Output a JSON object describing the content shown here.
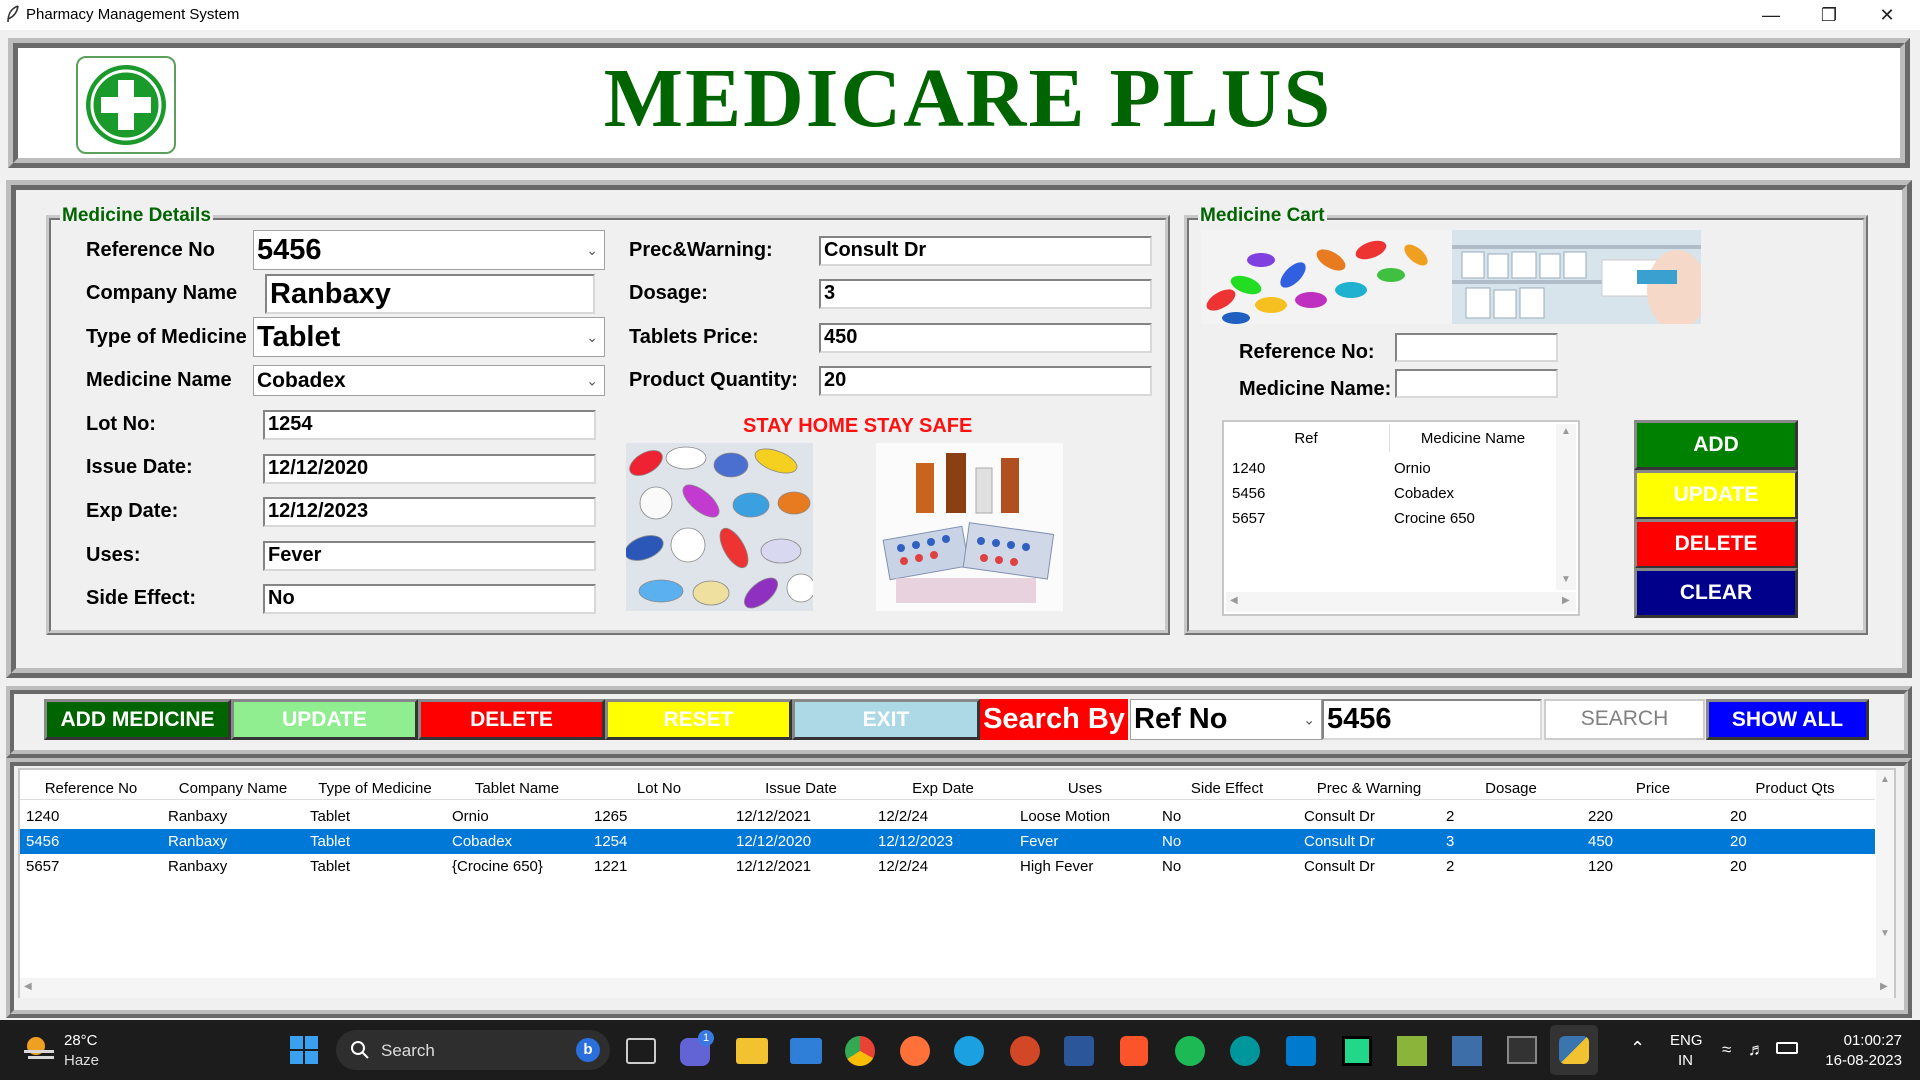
{
  "window": {
    "title": "Pharmacy Management System"
  },
  "header": {
    "title": "MEDICARE PLUS"
  },
  "medicine_details": {
    "group_label": "Medicine Details",
    "reference_no": {
      "label": "Reference No",
      "value": "5456"
    },
    "company_name": {
      "label": "Company Name",
      "value": "Ranbaxy"
    },
    "type_of_medicine": {
      "label": "Type of Medicine",
      "value": "Tablet"
    },
    "medicine_name": {
      "label": "Medicine Name",
      "value": "Cobadex"
    },
    "lot_no": {
      "label": "Lot No:",
      "value": "1254"
    },
    "issue_date": {
      "label": "Issue Date:",
      "value": "12/12/2020"
    },
    "exp_date": {
      "label": "Exp Date:",
      "value": "12/12/2023"
    },
    "uses": {
      "label": "Uses:",
      "value": "Fever"
    },
    "side_effect": {
      "label": "Side Effect:",
      "value": "No"
    },
    "prec_warning": {
      "label": "Prec&Warning:",
      "value": "Consult Dr"
    },
    "dosage": {
      "label": "Dosage:",
      "value": "3"
    },
    "tablets_price": {
      "label": "Tablets Price:",
      "value": "450"
    },
    "product_quantity": {
      "label": "Product Quantity:",
      "value": "20"
    },
    "slogan": "STAY HOME STAY SAFE"
  },
  "medicine_cart": {
    "group_label": "Medicine Cart",
    "reference_no": {
      "label": "Reference No:",
      "value": ""
    },
    "medicine_name": {
      "label": "Medicine Name:",
      "value": ""
    },
    "columns": [
      "Ref",
      "Medicine Name"
    ],
    "rows": [
      {
        "ref": "1240",
        "name": "Ornio"
      },
      {
        "ref": "5456",
        "name": "Cobadex"
      },
      {
        "ref": "5657",
        "name": "Crocine 650"
      }
    ],
    "buttons": {
      "add": "ADD",
      "update": "UPDATE",
      "delete": "DELETE",
      "clear": "CLEAR"
    }
  },
  "toolbar": {
    "add_medicine": "ADD MEDICINE",
    "update": "UPDATE",
    "delete": "DELETE",
    "reset": "RESET",
    "exit": "EXIT",
    "search_by_label": "Search By",
    "search_by_value": "Ref No",
    "search_value": "5456",
    "search": "SEARCH",
    "show_all": "SHOW ALL"
  },
  "table": {
    "columns": [
      "Reference No",
      "Company Name",
      "Type of Medicine",
      "Tablet Name",
      "Lot No",
      "Issue Date",
      "Exp Date",
      "Uses",
      "Side Effect",
      "Prec & Warning",
      "Dosage",
      "Price",
      "Product Qts"
    ],
    "rows": [
      [
        "1240",
        "Ranbaxy",
        "Tablet",
        "Ornio",
        "1265",
        "12/12/2021",
        "12/2/24",
        "Loose Motion",
        "No",
        "Consult Dr",
        "2",
        "220",
        "20"
      ],
      [
        "5456",
        "Ranbaxy",
        "Tablet",
        "Cobadex",
        "1254",
        "12/12/2020",
        "12/12/2023",
        "Fever",
        "No",
        "Consult Dr",
        "3",
        "450",
        "20"
      ],
      [
        "5657",
        "Ranbaxy",
        "Tablet",
        "{Crocine 650}",
        "1221",
        "12/12/2021",
        "12/2/24",
        "High Fever",
        "No",
        "Consult Dr",
        "2",
        "120",
        "20"
      ]
    ],
    "selected_row": 1
  },
  "taskbar": {
    "weather_temp": "28°C",
    "weather_desc": "Haze",
    "search_placeholder": "Search",
    "chat_badge": "1",
    "lang_top": "ENG",
    "lang_bottom": "IN",
    "time": "01:00:27",
    "date": "16-08-2023"
  },
  "colors": {
    "brand_green": "#006400",
    "add": "#008000",
    "update_yellow": "#ffff00",
    "delete_red": "#ff0000",
    "clear_navy": "#00008b",
    "exit_lightblue": "#add8e6",
    "update_lightgreen": "#90ee90",
    "selection_blue": "#0078d7"
  }
}
